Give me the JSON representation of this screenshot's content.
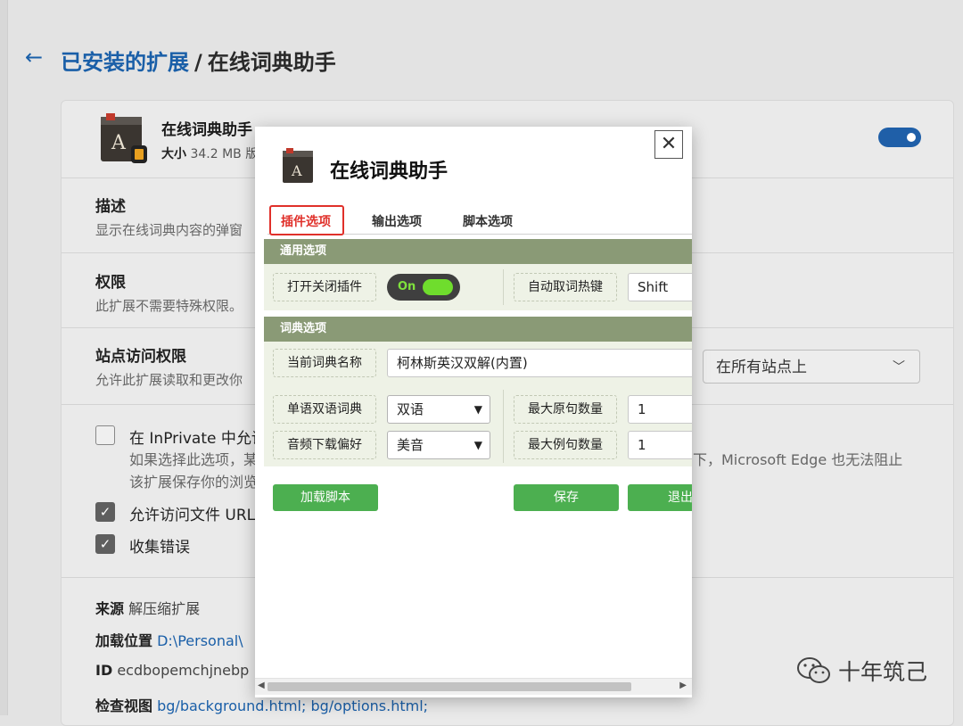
{
  "header": {
    "back_icon": "arrow-left-icon",
    "breadcrumb_link": "已安装的扩展",
    "breadcrumb_sep": "/",
    "breadcrumb_current": "在线词典助手"
  },
  "extension": {
    "name": "在线词典助手",
    "size_label": "大小",
    "size_value": "34.2 MB",
    "size_trailing": "版",
    "enabled": true
  },
  "sections": {
    "description_title": "描述",
    "description_text": "显示在线词典内容的弹窗",
    "permissions_title": "权限",
    "permissions_text": "此扩展不需要特殊权限。",
    "site_access_title": "站点访问权限",
    "site_access_text": "允许此扩展读取和更改你",
    "site_access_select": "在所有站点上"
  },
  "checkboxes": {
    "inprivate_label": "在 InPrivate 中允许",
    "inprivate_note1_left": "如果选择此选项，某",
    "inprivate_note1_right": "下，Microsoft Edge 也无法阻止",
    "inprivate_note2": "该扩展保存你的浏览",
    "file_urls_label": "允许访问文件 URL",
    "collect_errors_label": "收集错误"
  },
  "info": {
    "source_label": "来源",
    "source_value": "解压缩扩展",
    "location_label": "加载位置",
    "location_value": "D:\\Personal\\",
    "id_label": "ID",
    "id_value": "ecdbopemchjnebp",
    "inspect_label": "检查视图",
    "inspect_link1": "bg/background.html;",
    "inspect_link2": "bg/options.html;"
  },
  "popup": {
    "close_icon": "close-icon",
    "title": "在线词典助手",
    "tabs": [
      "插件选项",
      "输出选项",
      "脚本选项"
    ],
    "general_group": "通用选项",
    "toggle_plugin_label": "打开关闭插件",
    "toggle_state": "On",
    "hotkey_label": "自动取词热键",
    "hotkey_value": "Shift",
    "dict_group": "词典选项",
    "current_dict_label": "当前词典名称",
    "current_dict_value": "柯林斯英汉双解(内置)",
    "lang_mode_label": "单语双语词典",
    "lang_mode_value": "双语",
    "max_orig_label": "最大原句数量",
    "max_orig_value": "1",
    "audio_label": "音频下载偏好",
    "audio_value": "美音",
    "max_example_label": "最大例句数量",
    "max_example_value": "1",
    "load_script_btn": "加载脚本",
    "save_btn": "保存",
    "exit_btn": "退出"
  },
  "watermark": {
    "icon": "wechat-icon",
    "text": "十年筑己"
  },
  "colors": {
    "link_blue": "#1a5fa8",
    "group_header": "#8a9a76",
    "green_button": "#4caf50",
    "tab_active_red": "#e0302a",
    "toggle_green": "#6fdd2d"
  }
}
